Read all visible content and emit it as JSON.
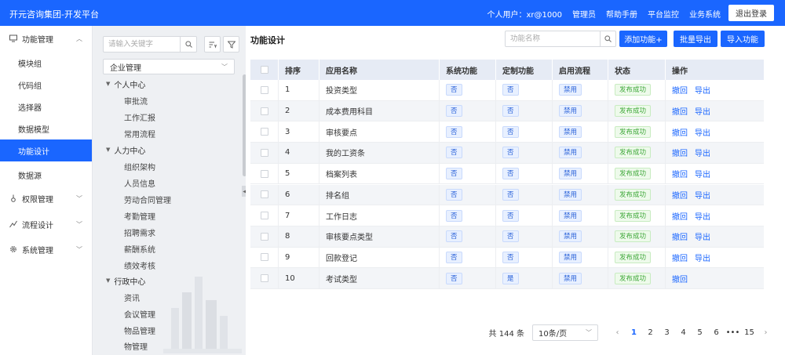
{
  "header": {
    "title": "开元咨询集团-开发平台",
    "user": "个人用户：xr@1000",
    "nav": [
      "管理员",
      "帮助手册",
      "平台监控",
      "业务系统"
    ],
    "logout": "退出登录"
  },
  "sidebar": {
    "groups": [
      {
        "icon": "monitor-icon",
        "label": "功能管理",
        "arrow": "^",
        "expanded": true,
        "children": [
          "模块组",
          "代码组",
          "选择器",
          "数据模型",
          "功能设计",
          "数据源"
        ],
        "active": "功能设计"
      },
      {
        "icon": "key-icon",
        "label": "权限管理",
        "arrow": "v"
      },
      {
        "icon": "flow-icon",
        "label": "流程设计",
        "arrow": "v"
      },
      {
        "icon": "gear-icon",
        "label": "系统管理",
        "arrow": "v"
      }
    ]
  },
  "tree": {
    "search_placeholder": "请输入关键字",
    "select_value": "企业管理",
    "groups": [
      {
        "label": "个人中心",
        "children": [
          "审批流",
          "工作汇报",
          "常用流程"
        ]
      },
      {
        "label": "人力中心",
        "children": [
          "组织架构",
          "人员信息",
          "劳动合同管理",
          "考勤管理",
          "招聘需求",
          "薪酬系统",
          "绩效考核"
        ]
      },
      {
        "label": "行政中心",
        "children": [
          "资讯",
          "会议管理",
          "物品管理",
          "物管理"
        ]
      }
    ]
  },
  "main": {
    "title": "功能设计",
    "search_placeholder": "功能名称",
    "buttons": {
      "add": "添加功能+",
      "export": "批量导出",
      "import": "导入功能"
    },
    "columns": [
      "排序",
      "应用名称",
      "系统功能",
      "定制功能",
      "启用流程",
      "状态",
      "操作"
    ],
    "rows": [
      {
        "no": "1",
        "name": "投资类型",
        "sys": "否",
        "custom": "否",
        "flow": "禁用",
        "status": "发布成功",
        "ops": [
          "撤回",
          "导出"
        ]
      },
      {
        "no": "2",
        "name": "成本费用科目",
        "sys": "否",
        "custom": "否",
        "flow": "禁用",
        "status": "发布成功",
        "ops": [
          "撤回",
          "导出"
        ]
      },
      {
        "no": "3",
        "name": "审核要点",
        "sys": "否",
        "custom": "否",
        "flow": "禁用",
        "status": "发布成功",
        "ops": [
          "撤回",
          "导出"
        ]
      },
      {
        "no": "4",
        "name": "我的工资条",
        "sys": "否",
        "custom": "否",
        "flow": "禁用",
        "status": "发布成功",
        "ops": [
          "撤回",
          "导出"
        ]
      },
      {
        "no": "5",
        "name": "档案列表",
        "sys": "否",
        "custom": "否",
        "flow": "禁用",
        "status": "发布成功",
        "ops": [
          "撤回",
          "导出"
        ]
      },
      {
        "no": "6",
        "name": "排名组",
        "sys": "否",
        "custom": "否",
        "flow": "禁用",
        "status": "发布成功",
        "ops": [
          "撤回",
          "导出"
        ]
      },
      {
        "no": "7",
        "name": "工作日志",
        "sys": "否",
        "custom": "否",
        "flow": "禁用",
        "status": "发布成功",
        "ops": [
          "撤回",
          "导出"
        ]
      },
      {
        "no": "8",
        "name": "审核要点类型",
        "sys": "否",
        "custom": "否",
        "flow": "禁用",
        "status": "发布成功",
        "ops": [
          "撤回",
          "导出"
        ]
      },
      {
        "no": "9",
        "name": "回款登记",
        "sys": "否",
        "custom": "否",
        "flow": "禁用",
        "status": "发布成功",
        "ops": [
          "撤回",
          "导出"
        ]
      },
      {
        "no": "10",
        "name": "考试类型",
        "sys": "否",
        "custom": "是",
        "flow": "禁用",
        "status": "发布成功",
        "ops": [
          "撤回"
        ]
      }
    ]
  },
  "pager": {
    "total": "共 144 条",
    "page_size": "10条/页",
    "prev": "‹",
    "next": "›",
    "pages": [
      "1",
      "2",
      "3",
      "4",
      "5",
      "6",
      "•••",
      "15"
    ],
    "current": "1"
  },
  "colors": {
    "primary": "#1a66ff",
    "success": "#3fa83a"
  }
}
